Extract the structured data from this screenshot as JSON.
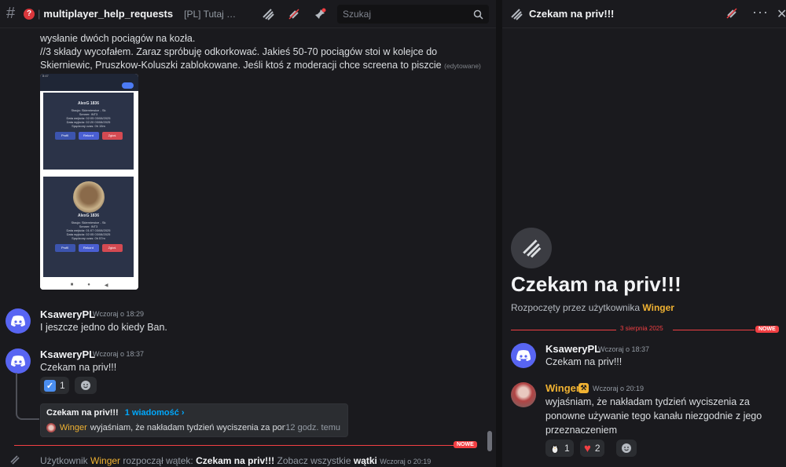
{
  "header": {
    "hash": "#",
    "question": "?",
    "separator": "|",
    "channel_name": "multiplayer_help_requests",
    "topic": "[PL] Tutaj mo...",
    "icons": [
      "threads-icon",
      "mute-icon",
      "pin-icon",
      "members-icon"
    ],
    "search_placeholder": "Szukaj"
  },
  "messages": {
    "line1": "wysłanie dwóch pociągów na kozła.",
    "line2": "//3 składy wycofałem. Zaraz spróbuję odkorkować. Jakieś 50-70 pociągów stoi w kolejce do",
    "line3": "Skierniewic, Pruszkow-Koluszki zablokowane. Jeśli ktoś z moderacji chce screena to piszcie",
    "edited": "(edytowane)"
  },
  "screenshot": {
    "status": "8:47",
    "cards": [
      {
        "name": "AlexG 1836",
        "l1": "Stacja: Skierniewice - Sk",
        "l2": "Serwer: INT3",
        "l3": "Data wejścia: 02:05 03/08/2025",
        "l4": "Data wyjścia: 02:20 03/08/2025",
        "l5": "Spędzony czas: 0h 15m"
      },
      {
        "name": "AlexG 1836",
        "l1": "Stacja: Skierniewice - Sk",
        "l2": "Serwer: INT3",
        "l3": "Data wejścia: 01:07 03/08/2025",
        "l4": "Data wyjścia: 02:05 03/08/2025",
        "l5": "Spędzony czas: 0h 57m"
      }
    ],
    "buttons": [
      "Profil",
      "Rekord",
      "Zgłoś"
    ]
  },
  "msg2": {
    "user": "KsaweryPL",
    "time": "Wczoraj o 18:29",
    "text": "I jeszcze jedno do kiedy Ban."
  },
  "msg3": {
    "user": "KsaweryPL",
    "time": "Wczoraj o 18:37",
    "text": "Czekam na priv!!!",
    "reaction_count": "1"
  },
  "thread_preview": {
    "title": "Czekam na priv!!!",
    "count": "1 wiadomość ›",
    "user": "Winger",
    "snippet": "wyjaśniam, że nakładam tydzień wyciszenia za pono...",
    "time": "12 godz. temu"
  },
  "new_tag": "NOWE",
  "system": {
    "prefix": "Użytkownik",
    "user": "Winger",
    "mid": "rozpoczął wątek:",
    "thread": "Czekam na priv!!!",
    "see": "Zobacz wszystkie",
    "threads": "wątki",
    "time": "Wczoraj o 20:19"
  },
  "thread_panel": {
    "title": "Czekam na priv!!!",
    "big_title": "Czekam na priv!!!",
    "started_by": "Rozpoczęty przez użytkownika",
    "starter": "Winger",
    "date": "3 sierpnia 2025",
    "new_tag": "NOWE",
    "m1_user": "KsaweryPL",
    "m1_time": "Wczoraj o 18:37",
    "m1_text": "Czekam na priv!!!",
    "m2_user": "Winger",
    "m2_time": "Wczoraj o 20:19",
    "m2_l1": "wyjaśniam, że nakładam tydzień wyciszenia za",
    "m2_l2": "ponowne używanie tego kanału niezgodnie z jego",
    "m2_l3": "przeznaczeniem",
    "r1_count": "1",
    "r2_count": "2"
  },
  "colors": {
    "accent": "#5865f2",
    "new": "#f23f43",
    "gold": "#f0b232"
  }
}
